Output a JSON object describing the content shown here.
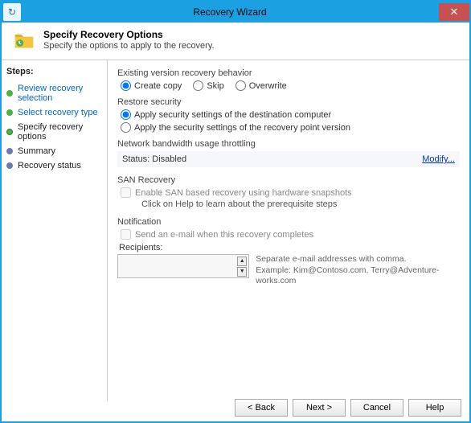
{
  "window": {
    "title": "Recovery Wizard"
  },
  "header": {
    "title": "Specify Recovery Options",
    "subtitle": "Specify the options to apply to the recovery."
  },
  "sidebar": {
    "title": "Steps:",
    "items": [
      {
        "label": "Review recovery selection",
        "state": "done"
      },
      {
        "label": "Select recovery type",
        "state": "done"
      },
      {
        "label": "Specify recovery options",
        "state": "current"
      },
      {
        "label": "Summary",
        "state": "future"
      },
      {
        "label": "Recovery status",
        "state": "future"
      }
    ]
  },
  "content": {
    "versionBehavior": {
      "label": "Existing version recovery behavior",
      "options": {
        "create": "Create copy",
        "skip": "Skip",
        "overwrite": "Overwrite"
      },
      "selected": "create"
    },
    "restoreSecurity": {
      "label": "Restore security",
      "options": {
        "dest": "Apply security settings of the destination computer",
        "point": "Apply the security settings of the recovery point version"
      },
      "selected": "dest"
    },
    "throttling": {
      "label": "Network bandwidth usage throttling",
      "status": "Status: Disabled",
      "modify": "Modify..."
    },
    "san": {
      "label": "SAN Recovery",
      "checkbox": "Enable SAN based recovery using hardware snapshots",
      "note": "Click on Help to learn about the prerequisite steps"
    },
    "notification": {
      "label": "Notification",
      "checkbox": "Send an e-mail when this recovery completes",
      "recipientsLabel": "Recipients:",
      "hint1": "Separate e-mail addresses with comma.",
      "hint2": "Example: Kim@Contoso.com, Terry@Adventure-works.com"
    }
  },
  "buttons": {
    "back": "< Back",
    "next": "Next >",
    "cancel": "Cancel",
    "help": "Help"
  }
}
